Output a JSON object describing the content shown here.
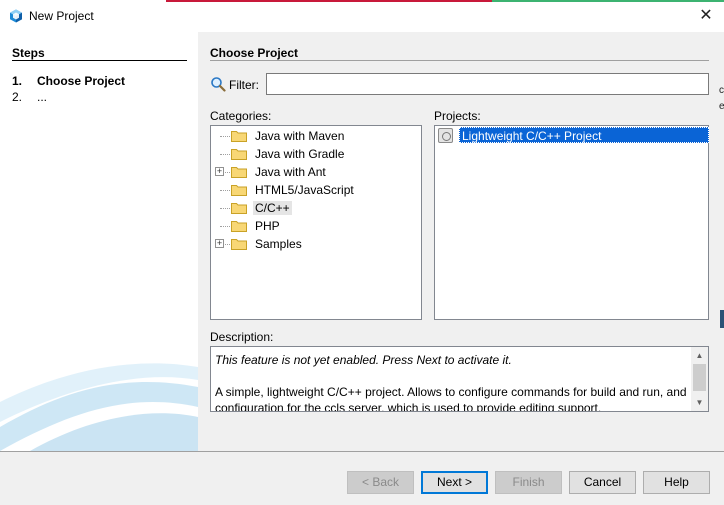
{
  "window": {
    "title": "New Project",
    "close_glyph": "✕",
    "accent_colors": [
      "#c8193a",
      "#3cb371"
    ]
  },
  "steps": {
    "header": "Steps",
    "items": [
      {
        "num": "1.",
        "label": "Choose Project"
      },
      {
        "num": "2.",
        "label": "..."
      }
    ]
  },
  "main": {
    "header": "Choose Project",
    "filter": {
      "label": "Filter:",
      "value": ""
    },
    "categories_label": "Categories:",
    "categories": [
      {
        "label": "Java with Maven",
        "expandable": false
      },
      {
        "label": "Java with Gradle",
        "expandable": false
      },
      {
        "label": "Java with Ant",
        "expandable": true
      },
      {
        "label": "HTML5/JavaScript",
        "expandable": false
      },
      {
        "label": "C/C++",
        "expandable": false,
        "selected": true
      },
      {
        "label": "PHP",
        "expandable": false
      },
      {
        "label": "Samples",
        "expandable": true
      }
    ],
    "projects_label": "Projects:",
    "projects": [
      {
        "label": "Lightweight C/C++ Project",
        "selected": true
      }
    ],
    "description_label": "Description:",
    "description": {
      "line1": "This feature is not yet enabled. Press Next to activate it.",
      "body": "A simple, lightweight C/C++ project. Allows to configure commands for build and run, and configuration for the ccls server, which is used to provide editing support."
    }
  },
  "buttons": {
    "back": "< Back",
    "next": "Next >",
    "finish": "Finish",
    "cancel": "Cancel",
    "help": "Help"
  },
  "edge": {
    "chars": [
      "c",
      "e"
    ]
  }
}
